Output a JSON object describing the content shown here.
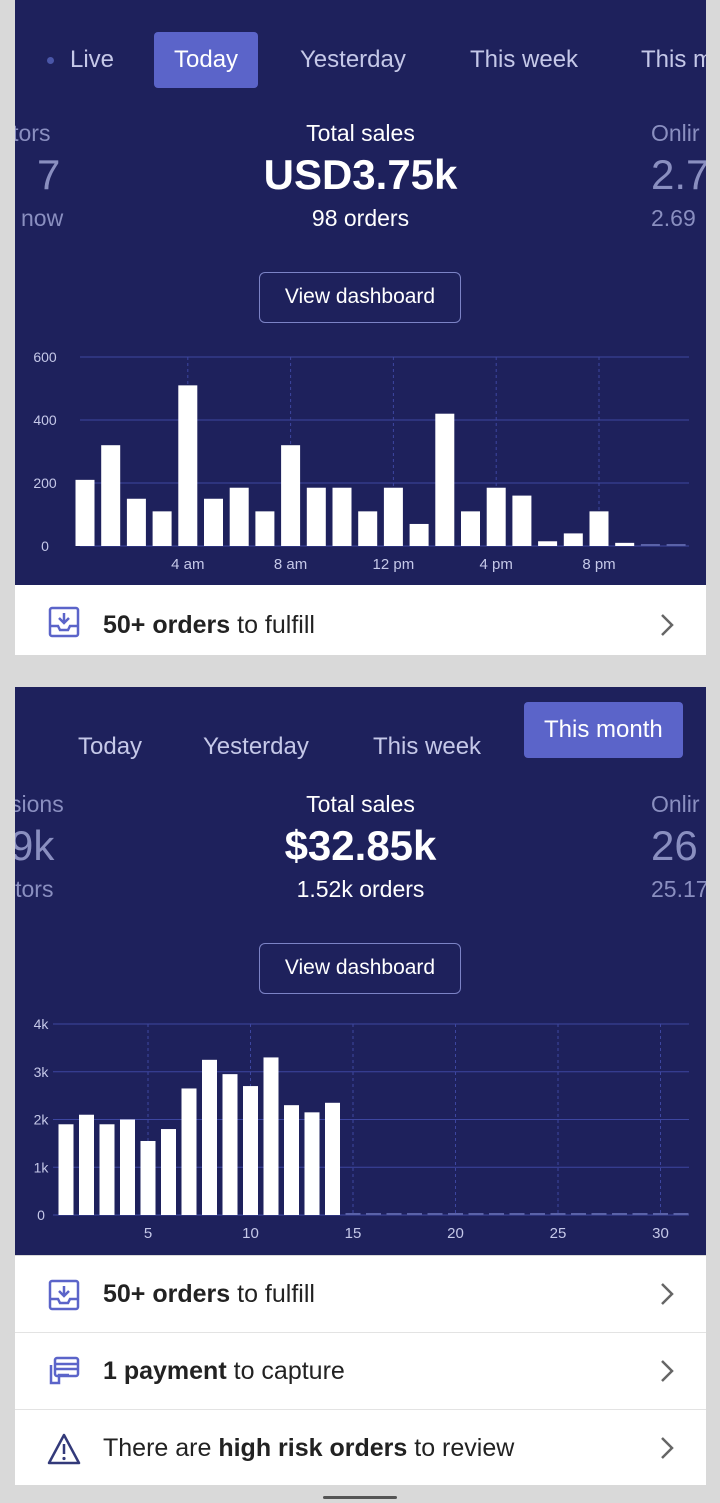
{
  "screen1": {
    "tabs": [
      {
        "label": "Live",
        "active": false
      },
      {
        "label": "Today",
        "active": true
      },
      {
        "label": "Yesterday",
        "active": false
      },
      {
        "label": "This week",
        "active": false
      },
      {
        "label": "This m",
        "active": false
      }
    ],
    "left_metric": {
      "title": "itors",
      "value": "7",
      "sub": "now"
    },
    "center_metric": {
      "title": "Total sales",
      "value": "USD3.75k",
      "sub": "98 orders"
    },
    "right_metric": {
      "title": "Onlir",
      "value": "2.7",
      "sub": "2.69"
    },
    "dashboard_button": "View dashboard",
    "task": {
      "strong": "50+ orders",
      "rest": " to fulfill",
      "icon": "inbox-download-icon"
    }
  },
  "screen2": {
    "tabs": [
      {
        "label": "Today",
        "active": false
      },
      {
        "label": "Yesterday",
        "active": false
      },
      {
        "label": "This week",
        "active": false
      },
      {
        "label": "This month",
        "active": true
      }
    ],
    "left_metric": {
      "title": "sions",
      "value": "9k",
      "sub": "itors"
    },
    "center_metric": {
      "title": "Total sales",
      "value": "$32.85k",
      "sub": "1.52k orders"
    },
    "right_metric": {
      "title": "Onlir",
      "value": "26",
      "sub": "25.17"
    },
    "dashboard_button": "View dashboard",
    "tasks": [
      {
        "prefix": "",
        "strong": "50+ orders",
        "rest": " to fulfill",
        "icon": "inbox-download-icon"
      },
      {
        "prefix": "",
        "strong": "1 payment",
        "rest": " to capture",
        "icon": "payment-card-icon"
      },
      {
        "prefix": "There are ",
        "strong": "high risk orders",
        "rest": " to review",
        "icon": "warning-triangle-icon"
      }
    ]
  },
  "colors": {
    "background": "#1e215c",
    "active_tab": "#5b64c9",
    "bar": "#ffffff",
    "grid": "#3d46a0"
  },
  "chart_data": [
    {
      "type": "bar",
      "title": "",
      "ylim": [
        0,
        600
      ],
      "yticks": [
        "0",
        "200",
        "400",
        "600"
      ],
      "xtick_labels": [
        "4 am",
        "8 am",
        "12 pm",
        "4 pm",
        "8 pm"
      ],
      "xtick_positions": [
        4,
        8,
        12,
        16,
        20
      ],
      "x": [
        0,
        1,
        2,
        3,
        4,
        5,
        6,
        7,
        8,
        9,
        10,
        11,
        12,
        13,
        14,
        15,
        16,
        17,
        18,
        19,
        20,
        21,
        22,
        23
      ],
      "values": [
        210,
        320,
        150,
        110,
        510,
        150,
        185,
        110,
        320,
        185,
        185,
        110,
        185,
        70,
        420,
        110,
        185,
        160,
        15,
        40,
        110,
        10,
        0,
        0
      ]
    },
    {
      "type": "bar",
      "title": "",
      "ylim": [
        0,
        4000
      ],
      "yticks": [
        "0",
        "1k",
        "2k",
        "3k",
        "4k"
      ],
      "xtick_labels": [
        "5",
        "10",
        "15",
        "20",
        "25",
        "30"
      ],
      "xtick_positions": [
        5,
        10,
        15,
        20,
        25,
        30
      ],
      "x": [
        1,
        2,
        3,
        4,
        5,
        6,
        7,
        8,
        9,
        10,
        11,
        12,
        13,
        14,
        15,
        16,
        17,
        18,
        19,
        20,
        21,
        22,
        23,
        24,
        25,
        26,
        27,
        28,
        29,
        30,
        31
      ],
      "values": [
        1900,
        2100,
        1900,
        2000,
        1550,
        1800,
        2650,
        3250,
        2950,
        2700,
        3300,
        2300,
        2150,
        2350,
        0,
        0,
        0,
        0,
        0,
        0,
        0,
        0,
        0,
        0,
        0,
        0,
        0,
        0,
        0,
        0,
        0
      ]
    }
  ]
}
